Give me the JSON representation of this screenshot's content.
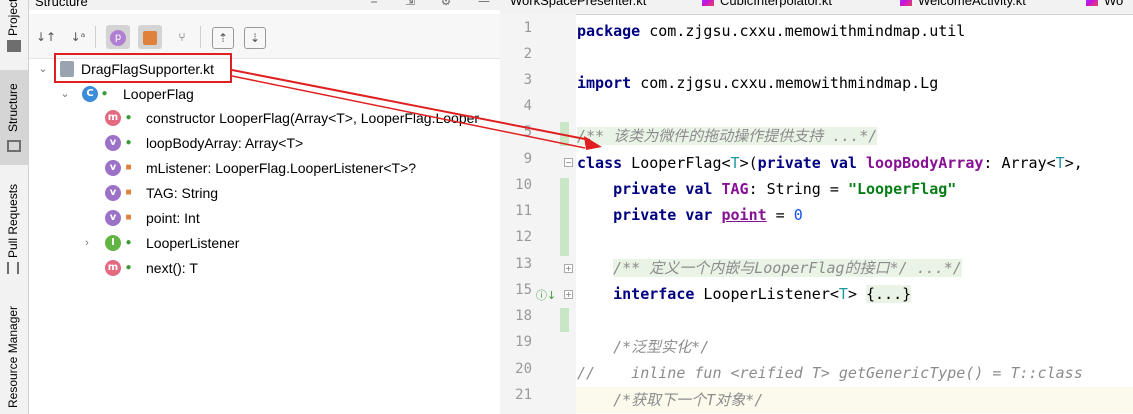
{
  "sidebar_left": {
    "tabs": [
      "Project",
      "Structure",
      "Pull Requests",
      "Resource Manager"
    ]
  },
  "structure": {
    "title": "Structure",
    "file_node": "DragFlagSupporter.kt",
    "class_node": "LooperFlag",
    "members": [
      {
        "badge": "m",
        "vis": "public",
        "label": "constructor LooperFlag(Array<T>, LooperFlag.Looper"
      },
      {
        "badge": "v",
        "vis": "public",
        "label": "loopBodyArray: Array<T>"
      },
      {
        "badge": "v",
        "vis": "private",
        "label": "mListener: LooperFlag.LooperListener<T>?"
      },
      {
        "badge": "v",
        "vis": "private",
        "label": "TAG: String"
      },
      {
        "badge": "v",
        "vis": "private",
        "label": "point: Int"
      },
      {
        "badge": "I",
        "vis": "public",
        "label": "LooperListener"
      },
      {
        "badge": "m",
        "vis": "public",
        "label": "next(): T"
      }
    ]
  },
  "editor": {
    "tabs": [
      "WorkSpacePresenter.kt",
      "CubicInterpolator.kt",
      "WelcomeActivity.kt",
      "Wo"
    ],
    "line_numbers": [
      "1",
      "2",
      "3",
      "4",
      "5",
      "9",
      "10",
      "11",
      "12",
      "13",
      "15",
      "18",
      "19",
      "20",
      "21"
    ],
    "code": {
      "l1_kw": "package",
      "l1_rest": " com.zjgsu.cxxu.memowithmindmap.util",
      "l3_kw": "import",
      "l3_rest": " com.zjgsu.cxxu.memowithmindmap.Lg",
      "l5_doc": "/** 该类为微件的拖动操作提供支持 ...*/",
      "l9_a": "class",
      "l9_b": " LooperFlag<",
      "l9_t": "T",
      "l9_c": ">(",
      "l9_d": "private val",
      "l9_e": " ",
      "l9_f": "loopBodyArray",
      "l9_g": ": Array<",
      "l9_h": "T",
      "l9_i": ">,",
      "l10_kw": "private val",
      "l10_prop": "TAG",
      "l10_mid": ": String = ",
      "l10_str": "\"LooperFlag\"",
      "l11_kw": "private var",
      "l11_prop": "point",
      "l11_mid": " = ",
      "l11_num": "0",
      "l13_doc": "/** 定义一个内嵌与LooperFlag的接口*/ ...*/",
      "l15_kw": "interface",
      "l15_mid": " LooperListener<",
      "l15_t": "T",
      "l15_end": "> ",
      "l15_fold": "{...}",
      "l19_cmt": "/*泛型实化*/",
      "l20_cmt": "//    inline fun <reified T> getGenericType() = T::class",
      "l21_cmt": "/*获取下一个T对象*/"
    }
  },
  "colors": {
    "highlight": "#e02020",
    "keyword": "#000080",
    "string": "#067d17",
    "property": "#871094"
  }
}
